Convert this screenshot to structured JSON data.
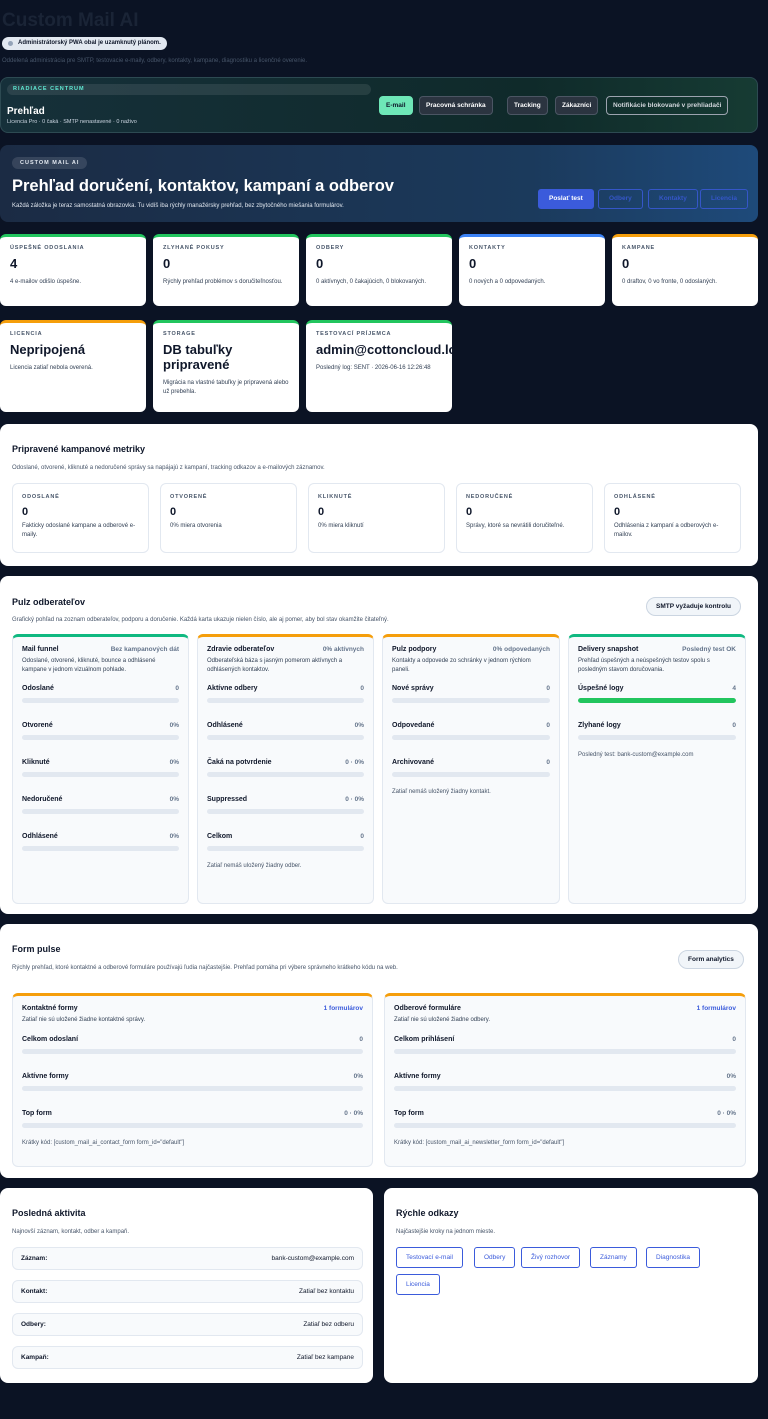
{
  "app": {
    "title": "Custom Mail AI",
    "pwa_status": "Administrátorský PWA obal je uzamknutý plánom.",
    "subtitle": "Oddelená administrácia pre SMTP, testovacie e-maily, odbery, kontakty, kampane, diagnostiku a licenčné overenie."
  },
  "control_center": {
    "kicker": "RIADIACE CENTRUM",
    "title": "Prehľad",
    "status": "Licencia Pro · 0 čaká · SMTP nenastavené · 0 naživo",
    "tabs": [
      {
        "label": "E-mail"
      },
      {
        "label": "Pracovná schránka"
      },
      {
        "label": "Tracking"
      },
      {
        "label": "Zákazníci"
      },
      {
        "label": "Notifikácie blokované v prehliadači"
      }
    ]
  },
  "hero": {
    "kicker": "CUSTOM MAIL AI",
    "title": "Prehľad doručení, kontaktov, kampaní a odberov",
    "subtitle": "Každá záložka je teraz samostatná obrazovka. Tu vidíš iba rýchly manažérsky prehľad, bez zbytočného miešania formulárov.",
    "buttons": [
      "Poslať test",
      "Odbery",
      "Kontakty",
      "Licencia"
    ]
  },
  "stats": [
    {
      "key": "ÚSPEŠNÉ ODOSLANIA",
      "value": "4",
      "desc": "4 e-mailov odišlo úspešne.",
      "color": "#22c55e"
    },
    {
      "key": "ZLYHANÉ POKUSY",
      "value": "0",
      "desc": "Rýchly prehľad problémov s doručiteľnosťou.",
      "color": "#22c55e"
    },
    {
      "key": "ODBERY",
      "value": "0",
      "desc": "0 aktívnych, 0 čakajúcich, 0 blokovaných.",
      "color": "#22c55e"
    },
    {
      "key": "KONTAKTY",
      "value": "0",
      "desc": "0 nových a 0 odpovedaných.",
      "color": "#3b82f6"
    },
    {
      "key": "KAMPANE",
      "value": "0",
      "desc": "0 draftov, 0 vo fronte, 0 odoslaných.",
      "color": "#f59e0b"
    },
    {
      "key": "LICENCIA",
      "value": "Nepripojená",
      "desc": "Licencia zatiaľ nebola overená.",
      "color": "#f59e0b"
    },
    {
      "key": "STORAGE",
      "value": "DB tabuľky pripravené",
      "desc": "Migrácia na vlastné tabuľky je pripravená alebo už prebehla.",
      "color": "#22c55e"
    },
    {
      "key": "TESTOVACÍ PRÍJEMCA",
      "value": "admin@cottoncloud.lo",
      "desc": "Posledný log: SENT · 2026-06-16 12:26:48",
      "color": "#22c55e"
    }
  ],
  "campaign_metrics": {
    "title": "Pripravené kampanové metriky",
    "subtitle": "Odoslané, otvorené, kliknuté a nedoručené správy sa napájajú z kampaní, tracking odkazov a e-mailových záznamov.",
    "items": [
      {
        "key": "ODOSLANÉ",
        "value": "0",
        "desc": "Fakticky odoslané kampane a odberové e-maily."
      },
      {
        "key": "OTVORENÉ",
        "value": "0",
        "desc": "0% miera otvorenia"
      },
      {
        "key": "KLIKNUTÉ",
        "value": "0",
        "desc": "0% miera kliknutí"
      },
      {
        "key": "NEDORUČENÉ",
        "value": "0",
        "desc": "Správy, ktoré sa nevrátili doručiteľné."
      },
      {
        "key": "ODHLÁSENÉ",
        "value": "0",
        "desc": "Odhlásenia z kampaní a odberových e-mailov."
      }
    ]
  },
  "pulse": {
    "title": "Pulz odberateľov",
    "subtitle": "Grafický pohľad na zoznam odberateľov, podporu a doručenie. Každá karta ukazuje nielen číslo, ale aj pomer, aby bol stav okamžite čitateľný.",
    "button": "SMTP vyžaduje kontrolu",
    "funnel": {
      "title": "Mail funnel",
      "tag": "Bez kampanových dát",
      "desc": "Odoslané, otvorené, kliknuté, bounce a odhlásené kampane v jednom vizuálnom pohlade.",
      "rows": [
        {
          "label": "Odoslané",
          "value": "0",
          "pct": 0
        },
        {
          "label": "Otvorené",
          "value": "0%",
          "pct": 0
        },
        {
          "label": "Kliknuté",
          "value": "0%",
          "pct": 0
        },
        {
          "label": "Nedoručené",
          "value": "0%",
          "pct": 0
        },
        {
          "label": "Odhlásené",
          "value": "0%",
          "pct": 0
        }
      ]
    },
    "health": {
      "title": "Zdravie odberateľov",
      "tag": "0% aktívnych",
      "desc": "Odberateľská báza s jasným pomerom aktívnych a odhlásených kontaktov.",
      "rows": [
        {
          "label": "Aktívne odbery",
          "value": "0",
          "pct": 0
        },
        {
          "label": "Odhlásené",
          "value": "0%",
          "pct": 0
        },
        {
          "label": "Čaká na potvrdenie",
          "value": "0 · 0%",
          "pct": 0
        },
        {
          "label": "Suppressed",
          "value": "0 · 0%",
          "pct": 0
        },
        {
          "label": "Celkom",
          "value": "0",
          "pct": 0
        }
      ],
      "foot": "Zatiaľ nemáš uložený žiadny odber."
    },
    "support": {
      "title": "Pulz podpory",
      "tag": "0% odpovedaných",
      "desc": "Kontakty a odpovede zo schránky v jednom rýchlom paneli.",
      "rows": [
        {
          "label": "Nové správy",
          "value": "0",
          "pct": 0
        },
        {
          "label": "Odpovedané",
          "value": "0",
          "pct": 0
        },
        {
          "label": "Archivované",
          "value": "0",
          "pct": 0
        }
      ],
      "foot": "Zatiaľ nemáš uložený žiadny kontakt."
    },
    "delivery": {
      "title": "Delivery snapshot",
      "tag": "Posledný test OK",
      "desc": "Prehľad úspešných a neúspešných testov spolu s posledným stavom doručovania.",
      "rows": [
        {
          "label": "Úspešné logy",
          "value": "4",
          "pct": 100
        },
        {
          "label": "Zlyhané logy",
          "value": "0",
          "pct": 0
        }
      ],
      "foot": "Posledný test: bank-custom@example.com"
    }
  },
  "forms": {
    "title": "Form pulse",
    "subtitle": "Rýchly prehľad, ktoré kontaktné a odberové formuláre používajú ľudia najčastejšie. Prehľad pomáha pri výbere správneho krátkeho kódu na web.",
    "button": "Form analytics",
    "contact": {
      "title": "Kontaktné formy",
      "tag": "1 formulárov",
      "desc": "Zatiaľ nie sú uložené žiadne kontaktné správy.",
      "rows": [
        {
          "label": "Celkom odoslaní",
          "value": "0",
          "pct": 0
        },
        {
          "label": "Aktívne formy",
          "value": "0%",
          "pct": 0
        },
        {
          "label": "Top form",
          "value": "0 · 0%",
          "pct": 0
        }
      ],
      "shortcode": "Krátky kód: [custom_mail_ai_contact_form form_id=\"default\"]"
    },
    "newsletter": {
      "title": "Odberové formuláre",
      "tag": "1 formulárov",
      "desc": "Zatiaľ nie sú uložené žiadne odbery.",
      "rows": [
        {
          "label": "Celkom prihlásení",
          "value": "0",
          "pct": 0
        },
        {
          "label": "Aktívne formy",
          "value": "0%",
          "pct": 0
        },
        {
          "label": "Top form",
          "value": "0 · 0%",
          "pct": 0
        }
      ],
      "shortcode": "Krátky kód: [custom_mail_ai_newsletter_form form_id=\"default\"]"
    }
  },
  "activity": {
    "title": "Posledná aktivita",
    "subtitle": "Najnovší záznam, kontakt, odber a kampaň.",
    "rows": [
      {
        "label": "Záznam:",
        "value": "bank-custom@example.com"
      },
      {
        "label": "Kontakt:",
        "value": "Zatiaľ bez kontaktu"
      },
      {
        "label": "Odbery:",
        "value": "Zatiaľ bez odberu"
      },
      {
        "label": "Kampaň:",
        "value": "Zatiaľ bez kampane"
      }
    ]
  },
  "quick_links": {
    "title": "Rýchle odkazy",
    "subtitle": "Najčastejšie kroky na jednom mieste.",
    "links": [
      "Testovací e-mail",
      "Odbery",
      "Živý rozhovor",
      "Záznamy",
      "Diagnostika",
      "Licencia"
    ]
  },
  "colors": {
    "page_bg": "#0b1324",
    "accent_green": "#22c55e",
    "accent_blue": "#3b5bdb",
    "accent_orange": "#f59e0b"
  }
}
